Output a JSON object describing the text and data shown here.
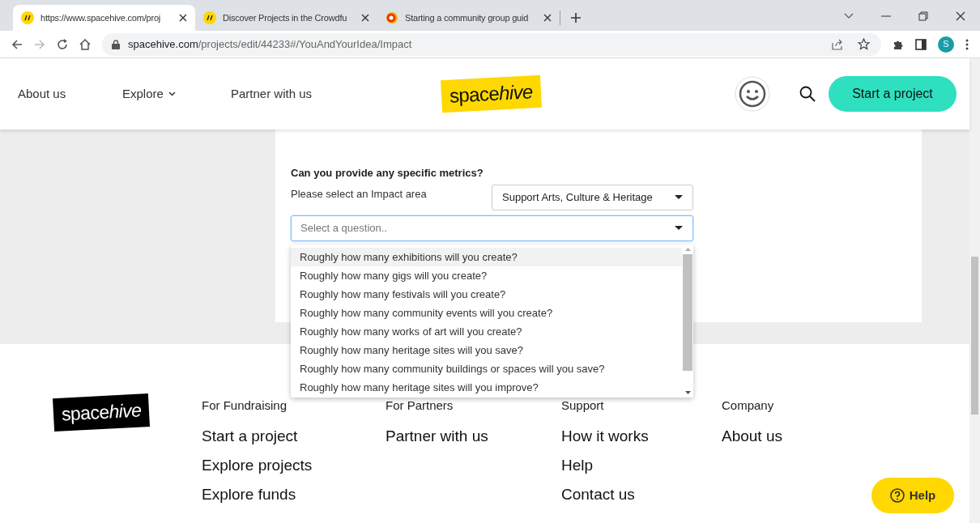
{
  "browser": {
    "tabs": [
      {
        "title": "https://www.spacehive.com/proj",
        "selected": true,
        "kind": "site"
      },
      {
        "title": "Discover Projects in the Crowdfu",
        "selected": false,
        "kind": "site"
      },
      {
        "title": "Starting a community group guid",
        "selected": false,
        "kind": "ring"
      }
    ],
    "address": {
      "domain": "spacehive.com",
      "path": "/projects/edit/44233#/YouAndYourIdea/Impact"
    },
    "profile_initial": "S"
  },
  "header": {
    "nav": [
      {
        "label": "About us",
        "kind": "link"
      },
      {
        "label": "Explore",
        "kind": "menu"
      },
      {
        "label": "Partner with us",
        "kind": "link"
      }
    ],
    "logo": [
      "space",
      "hive"
    ],
    "cta": "Start a project"
  },
  "form": {
    "heading": "Can you provide any specific metrics?",
    "impact_label": "Please select an Impact area",
    "impact_value": "Support Arts, Culture & Heritage",
    "question_placeholder": "Select a question..",
    "expanded": true,
    "options": [
      {
        "label": "Roughly how many exhibitions will you create?",
        "selected": true
      },
      {
        "label": "Roughly how many gigs will you create?",
        "selected": false
      },
      {
        "label": "Roughly how many festivals will you create?",
        "selected": false
      },
      {
        "label": "Roughly how many community events will you create?",
        "selected": false
      },
      {
        "label": "Roughly how many works of art will you create?",
        "selected": false
      },
      {
        "label": "Roughly how many heritage sites will you save?",
        "selected": false
      },
      {
        "label": "Roughly how many community buildings or spaces will you save?",
        "selected": false
      },
      {
        "label": "Roughly how many heritage sites will you improve?",
        "selected": false
      }
    ]
  },
  "footer": {
    "logo": [
      "space",
      "hive"
    ],
    "columns": [
      {
        "heading": "For Fundraising",
        "links": [
          "Start a project",
          "Explore projects",
          "Explore funds"
        ]
      },
      {
        "heading": "For Partners",
        "links": [
          "Partner with us"
        ]
      },
      {
        "heading": "Support",
        "links": [
          "How it works",
          "Help",
          "Contact us"
        ]
      },
      {
        "heading": "Company",
        "links": [
          "About us"
        ]
      }
    ],
    "help_button": "Help"
  }
}
